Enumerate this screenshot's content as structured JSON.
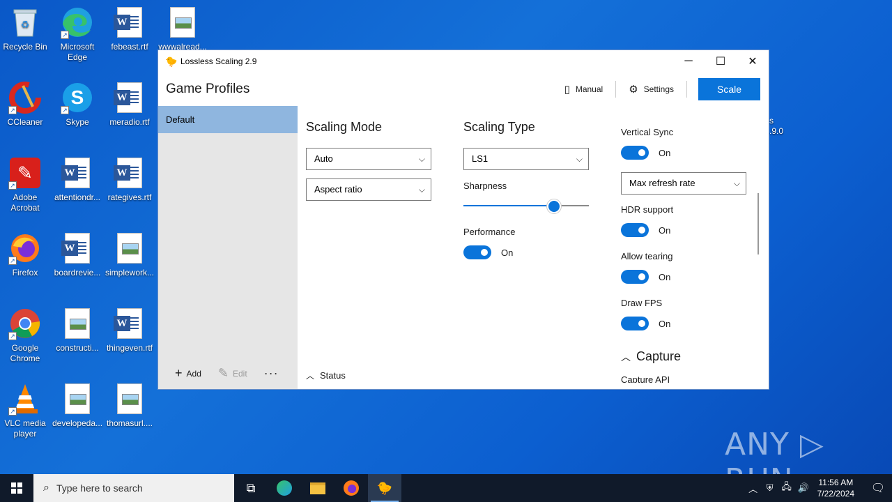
{
  "desktop": {
    "icons": [
      {
        "label": "Recycle Bin",
        "icon": "recycle-bin-icon"
      },
      {
        "label": "Microsoft Edge",
        "icon": "edge-icon"
      },
      {
        "label": "febeast.rtf",
        "icon": "word-doc-icon"
      },
      {
        "label": "wwwalread...",
        "icon": "image-file-icon"
      },
      {
        "label": "CCleaner",
        "icon": "ccleaner-icon"
      },
      {
        "label": "Skype",
        "icon": "skype-icon"
      },
      {
        "label": "meradio.rtf",
        "icon": "word-doc-icon"
      },
      {
        "label": "Adobe Acrobat",
        "icon": "acrobat-icon"
      },
      {
        "label": "attentiondr...",
        "icon": "word-doc-icon"
      },
      {
        "label": "rategives.rtf",
        "icon": "word-doc-icon"
      },
      {
        "label": "Firefox",
        "icon": "firefox-icon"
      },
      {
        "label": "boardrevie...",
        "icon": "word-doc-icon"
      },
      {
        "label": "simplework...",
        "icon": "image-file-icon"
      },
      {
        "label": "Google Chrome",
        "icon": "chrome-icon"
      },
      {
        "label": "constructi...",
        "icon": "image-file-icon"
      },
      {
        "label": "thingeven.rtf",
        "icon": "word-doc-icon"
      },
      {
        "label": "VLC media player",
        "icon": "vlc-icon"
      },
      {
        "label": "developeda...",
        "icon": "image-file-icon"
      },
      {
        "label": "thomasurl....",
        "icon": "image-file-icon"
      }
    ],
    "partial_text_1": "s",
    "partial_text_2": ".9.0"
  },
  "window": {
    "title": "Lossless Scaling 2.9",
    "controls": {
      "minimize": "─",
      "maximize": "☐",
      "close": "✕"
    },
    "page_title": "Game Profiles",
    "manual_label": "Manual",
    "settings_label": "Settings",
    "scale_label": "Scale",
    "profiles": [
      "Default"
    ],
    "footer": {
      "add": "Add",
      "edit": "Edit",
      "more": "···"
    },
    "scaling_mode": {
      "title": "Scaling Mode",
      "mode_value": "Auto",
      "fit_value": "Aspect ratio"
    },
    "scaling_type": {
      "title": "Scaling Type",
      "type_value": "LS1",
      "sharpness_label": "Sharpness",
      "sharpness_fraction": 0.72,
      "performance_label": "Performance",
      "performance_state": "On"
    },
    "rendering": {
      "vsync_label": "Vertical Sync",
      "vsync_state": "On",
      "vsync_mode": "Max refresh rate",
      "hdr_label": "HDR support",
      "hdr_state": "On",
      "tearing_label": "Allow tearing",
      "tearing_state": "On",
      "fps_label": "Draw FPS",
      "fps_state": "On",
      "capture_title": "Capture",
      "capture_api_label": "Capture API"
    },
    "status_label": "Status",
    "accent": "#0a74da"
  },
  "watermark": "ANY ▷ RUN",
  "taskbar": {
    "search_placeholder": "Type here to search",
    "time": "11:56 AM",
    "date": "7/22/2024"
  }
}
